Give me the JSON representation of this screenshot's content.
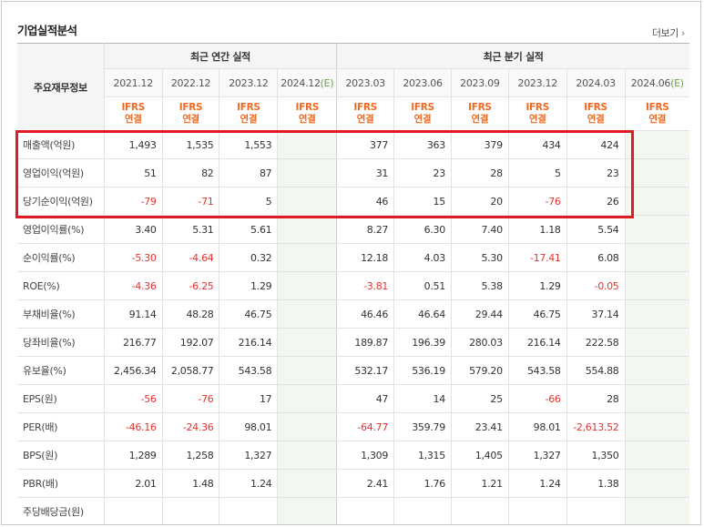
{
  "title": "기업실적분석",
  "more_label": "더보기",
  "header": {
    "row_header": "주요재무정보",
    "annual_group": "최근 연간 실적",
    "quarter_group": "최근 분기 실적",
    "periods": [
      "2021.12",
      "2022.12",
      "2023.12",
      "2024.12",
      "2023.03",
      "2023.06",
      "2023.09",
      "2023.12",
      "2024.03",
      "2024.06"
    ],
    "estimate_suffix": "(E)",
    "basis_line1": "IFRS",
    "basis_line2": "연결"
  },
  "rows": [
    {
      "label": "매출액(억원)",
      "values": [
        "1,493",
        "1,535",
        "1,553",
        "",
        "377",
        "363",
        "379",
        "434",
        "424",
        ""
      ]
    },
    {
      "label": "영업이익(억원)",
      "values": [
        "51",
        "82",
        "87",
        "",
        "31",
        "23",
        "28",
        "5",
        "23",
        ""
      ]
    },
    {
      "label": "당기순이익(억원)",
      "values": [
        "-79",
        "-71",
        "5",
        "",
        "46",
        "15",
        "20",
        "-76",
        "26",
        ""
      ]
    },
    {
      "label": "영업이익률(%)",
      "values": [
        "3.40",
        "5.31",
        "5.61",
        "",
        "8.27",
        "6.30",
        "7.40",
        "1.18",
        "5.54",
        ""
      ]
    },
    {
      "label": "순이익률(%)",
      "values": [
        "-5.30",
        "-4.64",
        "0.32",
        "",
        "12.18",
        "4.03",
        "5.30",
        "-17.41",
        "6.08",
        ""
      ]
    },
    {
      "label": "ROE(%)",
      "values": [
        "-4.36",
        "-6.25",
        "1.29",
        "",
        "-3.81",
        "0.51",
        "5.38",
        "1.29",
        "-0.05",
        ""
      ]
    },
    {
      "label": "부채비율(%)",
      "values": [
        "91.14",
        "48.28",
        "46.75",
        "",
        "46.46",
        "46.64",
        "29.44",
        "46.75",
        "37.14",
        ""
      ]
    },
    {
      "label": "당좌비율(%)",
      "values": [
        "216.77",
        "192.07",
        "216.14",
        "",
        "189.87",
        "196.39",
        "280.03",
        "216.14",
        "222.58",
        ""
      ]
    },
    {
      "label": "유보율(%)",
      "values": [
        "2,456.34",
        "2,058.77",
        "543.58",
        "",
        "532.17",
        "536.19",
        "579.20",
        "543.58",
        "554.88",
        ""
      ]
    },
    {
      "label": "EPS(원)",
      "values": [
        "-56",
        "-76",
        "17",
        "",
        "47",
        "14",
        "25",
        "-66",
        "28",
        ""
      ]
    },
    {
      "label": "PER(배)",
      "values": [
        "-46.16",
        "-24.36",
        "98.01",
        "",
        "-64.77",
        "359.79",
        "23.41",
        "98.01",
        "-2,613.52",
        ""
      ]
    },
    {
      "label": "BPS(원)",
      "values": [
        "1,289",
        "1,258",
        "1,327",
        "",
        "1,309",
        "1,315",
        "1,405",
        "1,327",
        "1,350",
        ""
      ]
    },
    {
      "label": "PBR(배)",
      "values": [
        "2.01",
        "1.48",
        "1.24",
        "",
        "2.41",
        "1.76",
        "1.21",
        "1.24",
        "1.38",
        ""
      ]
    },
    {
      "label": "주당배당금(원)",
      "values": [
        "",
        "",
        "",
        "",
        "",
        "",
        "",
        "",
        "",
        ""
      ]
    }
  ]
}
